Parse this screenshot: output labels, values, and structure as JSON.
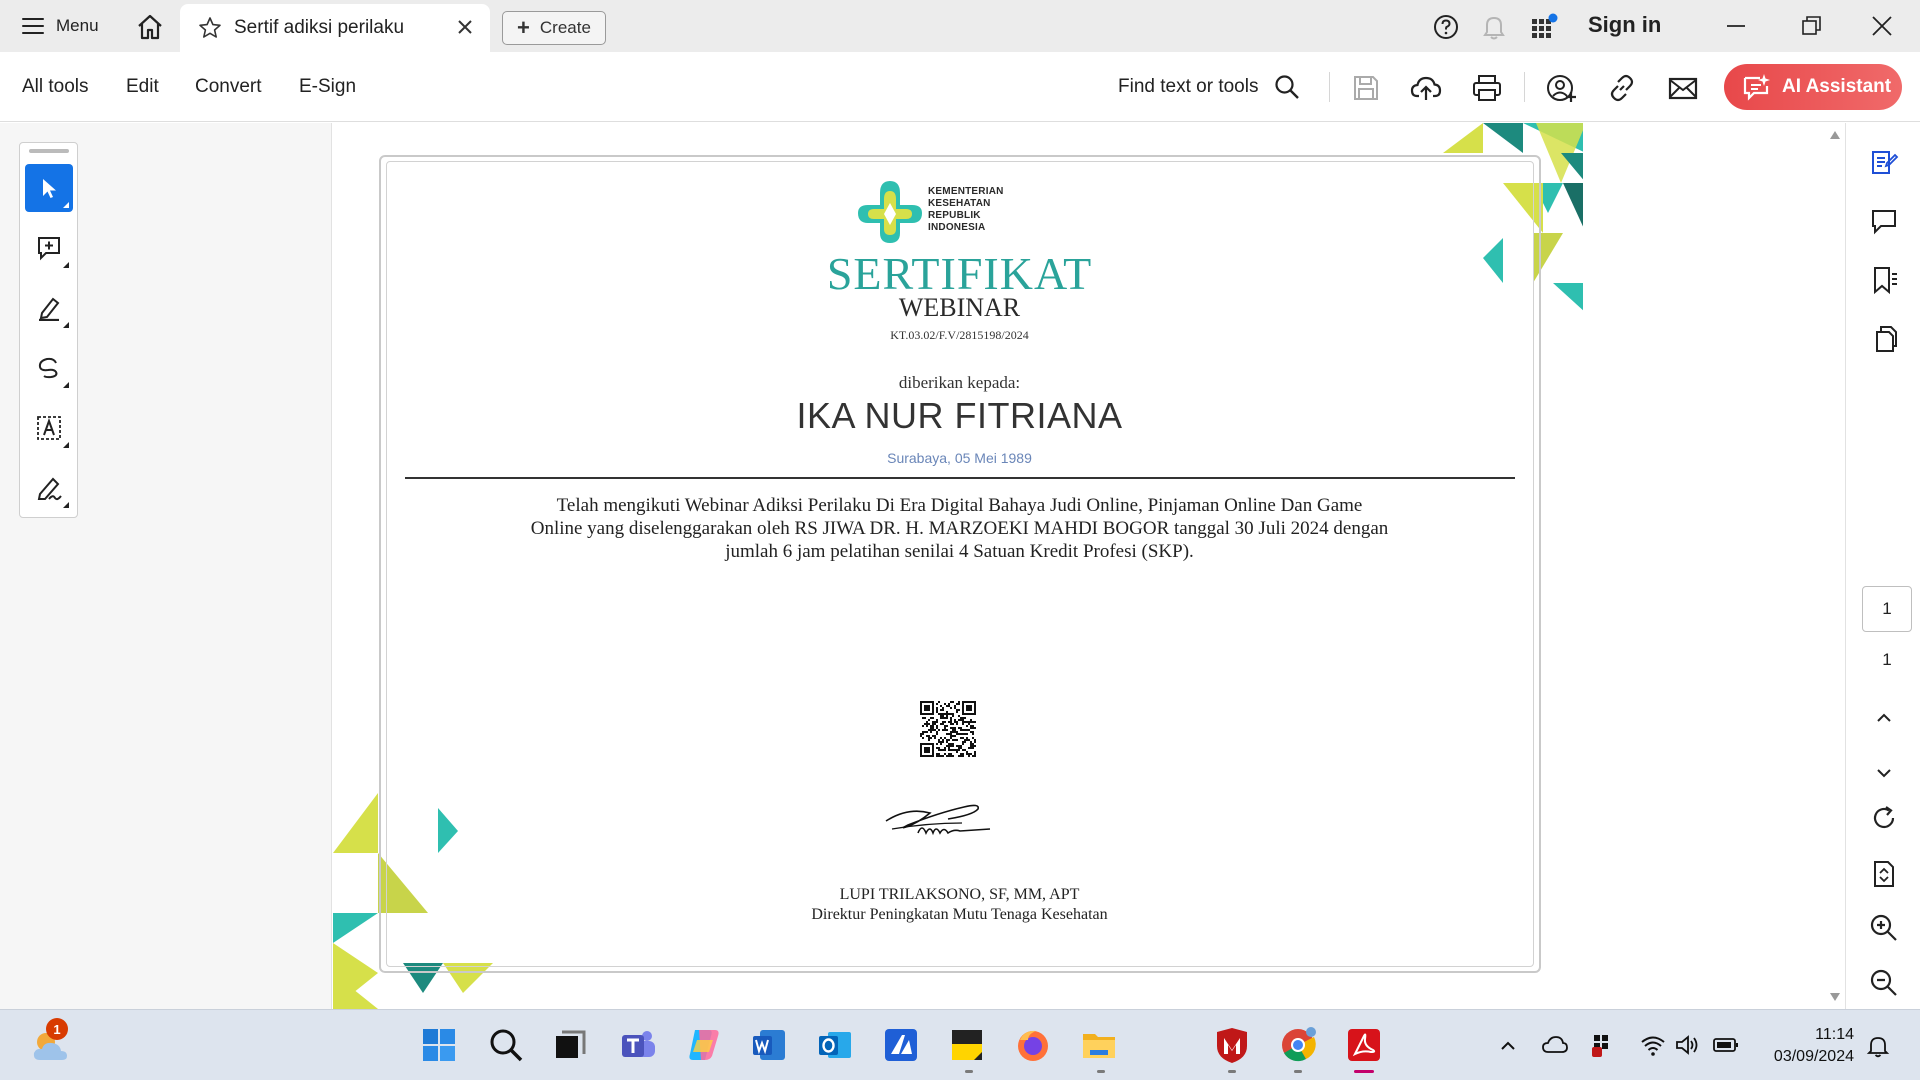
{
  "titlebar": {
    "menu_label": "Menu",
    "tab_title": "Sertif adiksi perilaku",
    "create_label": "Create",
    "sign_in_label": "Sign in"
  },
  "toolbar": {
    "menus": [
      "All tools",
      "Edit",
      "Convert",
      "E-Sign"
    ],
    "find_label": "Find text or tools",
    "ai_label": "AI Assistant",
    "accent_color": "#e8484a"
  },
  "left_tools": [
    "select-icon",
    "add-comment-icon",
    "highlight-icon",
    "draw-icon",
    "text-select-icon",
    "sign-icon"
  ],
  "document": {
    "logo_text": [
      "KEMENTERIAN",
      "KESEHATAN",
      "REPUBLIK",
      "INDONESIA"
    ],
    "title": "SERTIFIKAT",
    "subtitle": "WEBINAR",
    "number": "KT.03.02/F.V/2815198/2024",
    "given_to": "diberikan kepada:",
    "recipient_name": "IKA NUR FITRIANA",
    "birth_info": "Surabaya, 05 Mei 1989",
    "body_lines": [
      "Telah mengikuti Webinar Adiksi Perilaku Di Era Digital Bahaya Judi Online, Pinjaman Online Dan Game",
      "Online yang diselenggarakan oleh RS JIWA DR. H. MARZOEKI MAHDI BOGOR tanggal 30 Juli 2024 dengan",
      "jumlah 6 jam pelatihan senilai 4 Satuan Kredit Profesi (SKP)."
    ],
    "signer_name": "LUPI TRILAKSONO, SF, MM, APT",
    "signer_role": "Direktur Peningkatan Mutu Tenaga Kesehatan",
    "accent_teal": "#2aa39a",
    "accent_lime": "#d6e04a"
  },
  "right_panel": {
    "icons": [
      "export-pdf-icon",
      "comment-icon",
      "bookmark-icon",
      "pages-icon"
    ],
    "page_current": "1",
    "page_total": "1",
    "nav_icons": [
      "chevron-up-icon",
      "chevron-down-icon",
      "rotate-icon",
      "page-fit-icon",
      "zoom-in-icon",
      "zoom-out-icon"
    ]
  },
  "taskbar": {
    "weather_badge": "1",
    "apps": [
      "start-icon",
      "search-icon",
      "task-view-icon",
      "teams-icon",
      "copilot-icon",
      "word-icon",
      "outlook-icon",
      "azure-icon",
      "sticky-notes-icon",
      "firefox-icon",
      "file-explorer-icon",
      "mcafee-icon",
      "chrome-icon",
      "acrobat-icon"
    ],
    "time": "11:14",
    "date": "03/09/2024"
  }
}
